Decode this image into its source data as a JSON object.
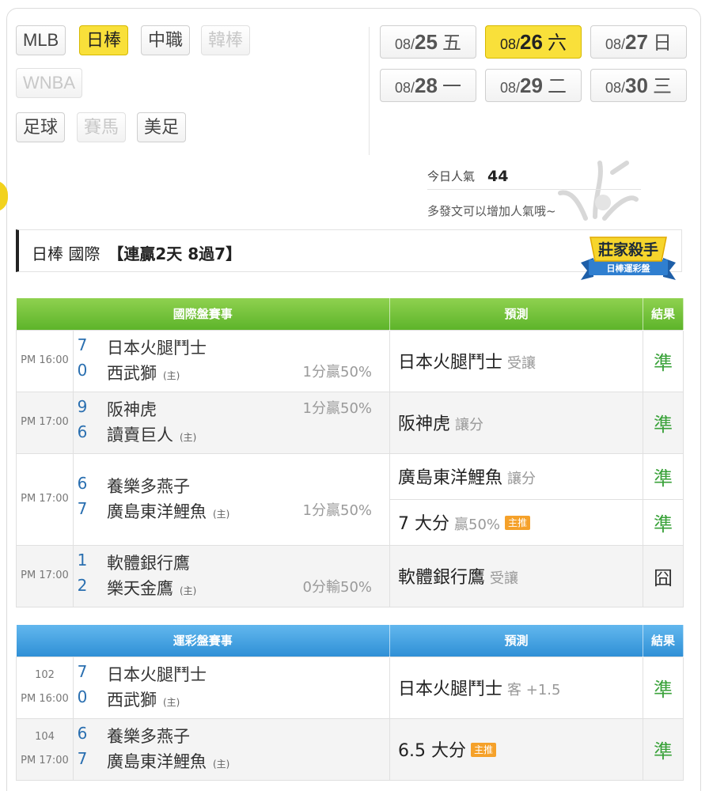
{
  "leagues": [
    {
      "label": "MLB",
      "state": "normal"
    },
    {
      "label": "日棒",
      "state": "active"
    },
    {
      "label": "中職",
      "state": "normal"
    },
    {
      "label": "韓棒",
      "state": "disabled"
    },
    {
      "label": "WNBA",
      "state": "disabled"
    },
    {
      "label": "足球",
      "state": "normal"
    },
    {
      "label": "賽馬",
      "state": "disabled"
    },
    {
      "label": "美足",
      "state": "normal"
    }
  ],
  "dates": [
    {
      "month": "08/",
      "day": "25",
      "weekday": "五"
    },
    {
      "month": "08/",
      "day": "26",
      "weekday": "六"
    },
    {
      "month": "08/",
      "day": "27",
      "weekday": "日"
    },
    {
      "month": "08/",
      "day": "28",
      "weekday": "一"
    },
    {
      "month": "08/",
      "day": "29",
      "weekday": "二"
    },
    {
      "month": "08/",
      "day": "30",
      "weekday": "三"
    }
  ],
  "popularity": {
    "label": "今日人氣",
    "value": "44",
    "hint": "多發文可以增加人氣哦~"
  },
  "title": {
    "prefix": "日棒 國際",
    "streak": "【連贏2天 8過7】"
  },
  "badge": {
    "title": "莊家殺手",
    "subtitle": "日棒運彩盤"
  },
  "intl": {
    "headers": {
      "game": "國際盤賽事",
      "prediction": "預測",
      "result": "結果"
    },
    "home_mark": "(主)",
    "rows": [
      {
        "time": "PM 16:00",
        "s1": "7",
        "t1": "日本火腿鬥士",
        "s2": "0",
        "t2": "西武獅",
        "hc1": "",
        "hc2": "1分贏50%",
        "pick": "日本火腿鬥士",
        "pick_note": "受讓",
        "result": "準"
      },
      {
        "time": "PM 17:00",
        "s1": "9",
        "t1": "阪神虎",
        "s2": "6",
        "t2": "讀賣巨人",
        "hc1": "1分贏50%",
        "hc2": "",
        "pick": "阪神虎",
        "pick_note": "讓分",
        "result": "準"
      },
      {
        "time": "PM 17:00",
        "s1": "6",
        "t1": "養樂多燕子",
        "s2": "7",
        "t2": "廣島東洋鯉魚",
        "hc1": "",
        "hc2": "1分贏50%",
        "pick": "廣島東洋鯉魚",
        "pick_note": "讓分",
        "result": "準",
        "pick2": "7 大分",
        "pick2_note": "贏50%",
        "pick2_tag": "主推",
        "result2": "準"
      },
      {
        "time": "PM 17:00",
        "s1": "1",
        "t1": "軟體銀行鷹",
        "s2": "2",
        "t2": "樂天金鷹",
        "hc1": "",
        "hc2": "0分輸50%",
        "pick": "軟體銀行鷹",
        "pick_note": "受讓",
        "result": "囧"
      }
    ]
  },
  "sports": {
    "headers": {
      "game": "運彩盤賽事",
      "prediction": "預測",
      "result": "結果"
    },
    "rows": [
      {
        "num": "102",
        "time": "PM 16:00",
        "s1": "7",
        "t1": "日本火腿鬥士",
        "s2": "0",
        "t2": "西武獅",
        "pick": "日本火腿鬥士",
        "pick_note": "客 +1.5",
        "result": "準"
      },
      {
        "num": "104",
        "time": "PM 17:00",
        "s1": "6",
        "t1": "養樂多燕子",
        "s2": "7",
        "t2": "廣島東洋鯉魚",
        "pick": "6.5 大分",
        "pick_tag": "主推",
        "result": "準"
      }
    ]
  }
}
